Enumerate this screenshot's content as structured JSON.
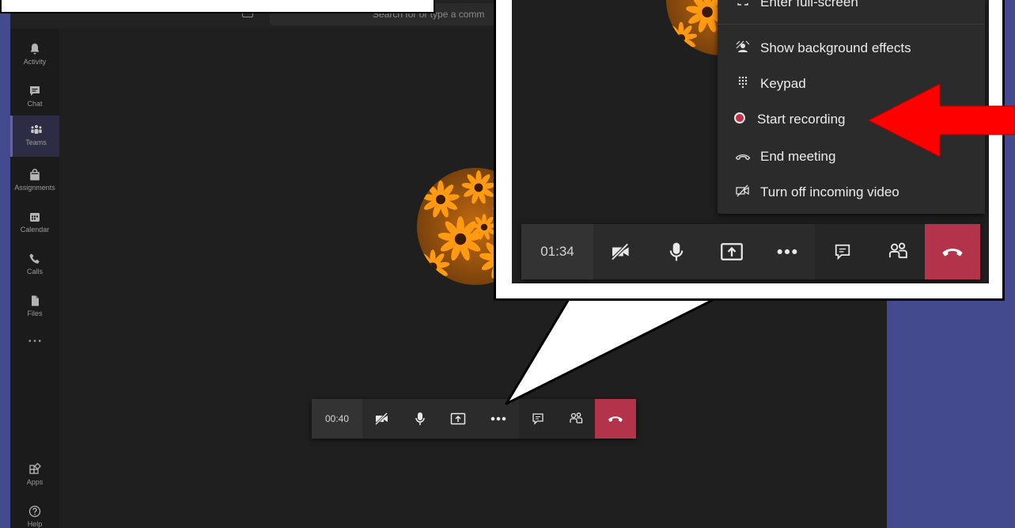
{
  "search": {
    "placeholder": "Search for or type a comm"
  },
  "rail": [
    {
      "label": "Activity",
      "icon": "bell-icon"
    },
    {
      "label": "Chat",
      "icon": "chat-icon"
    },
    {
      "label": "Teams",
      "icon": "teams-icon",
      "active": true
    },
    {
      "label": "Assignments",
      "icon": "assignments-icon"
    },
    {
      "label": "Calendar",
      "icon": "calendar-icon"
    },
    {
      "label": "Calls",
      "icon": "phone-icon"
    },
    {
      "label": "Files",
      "icon": "file-icon"
    },
    {
      "label": "Apps",
      "icon": "apps-icon"
    },
    {
      "label": "Help",
      "icon": "help-icon"
    }
  ],
  "rail_more": "• • •",
  "call": {
    "timer": "00:40"
  },
  "zoom": {
    "timer": "01:34",
    "menu": [
      {
        "label": "Enter full-screen",
        "icon": "fullscreen-icon"
      },
      {
        "label": "Show background effects",
        "icon": "background-effects-icon"
      },
      {
        "label": "Keypad",
        "icon": "keypad-icon"
      },
      {
        "label": "Start recording",
        "icon": "record-icon"
      },
      {
        "label": "End meeting",
        "icon": "end-meeting-icon"
      },
      {
        "label": "Turn off incoming video",
        "icon": "video-off-icon"
      }
    ]
  },
  "colors": {
    "accent": "#6264a7",
    "hangup": "#b3334a",
    "background": "#434a8d",
    "highlight_arrow": "#ff0000",
    "record": "#c4314b"
  }
}
